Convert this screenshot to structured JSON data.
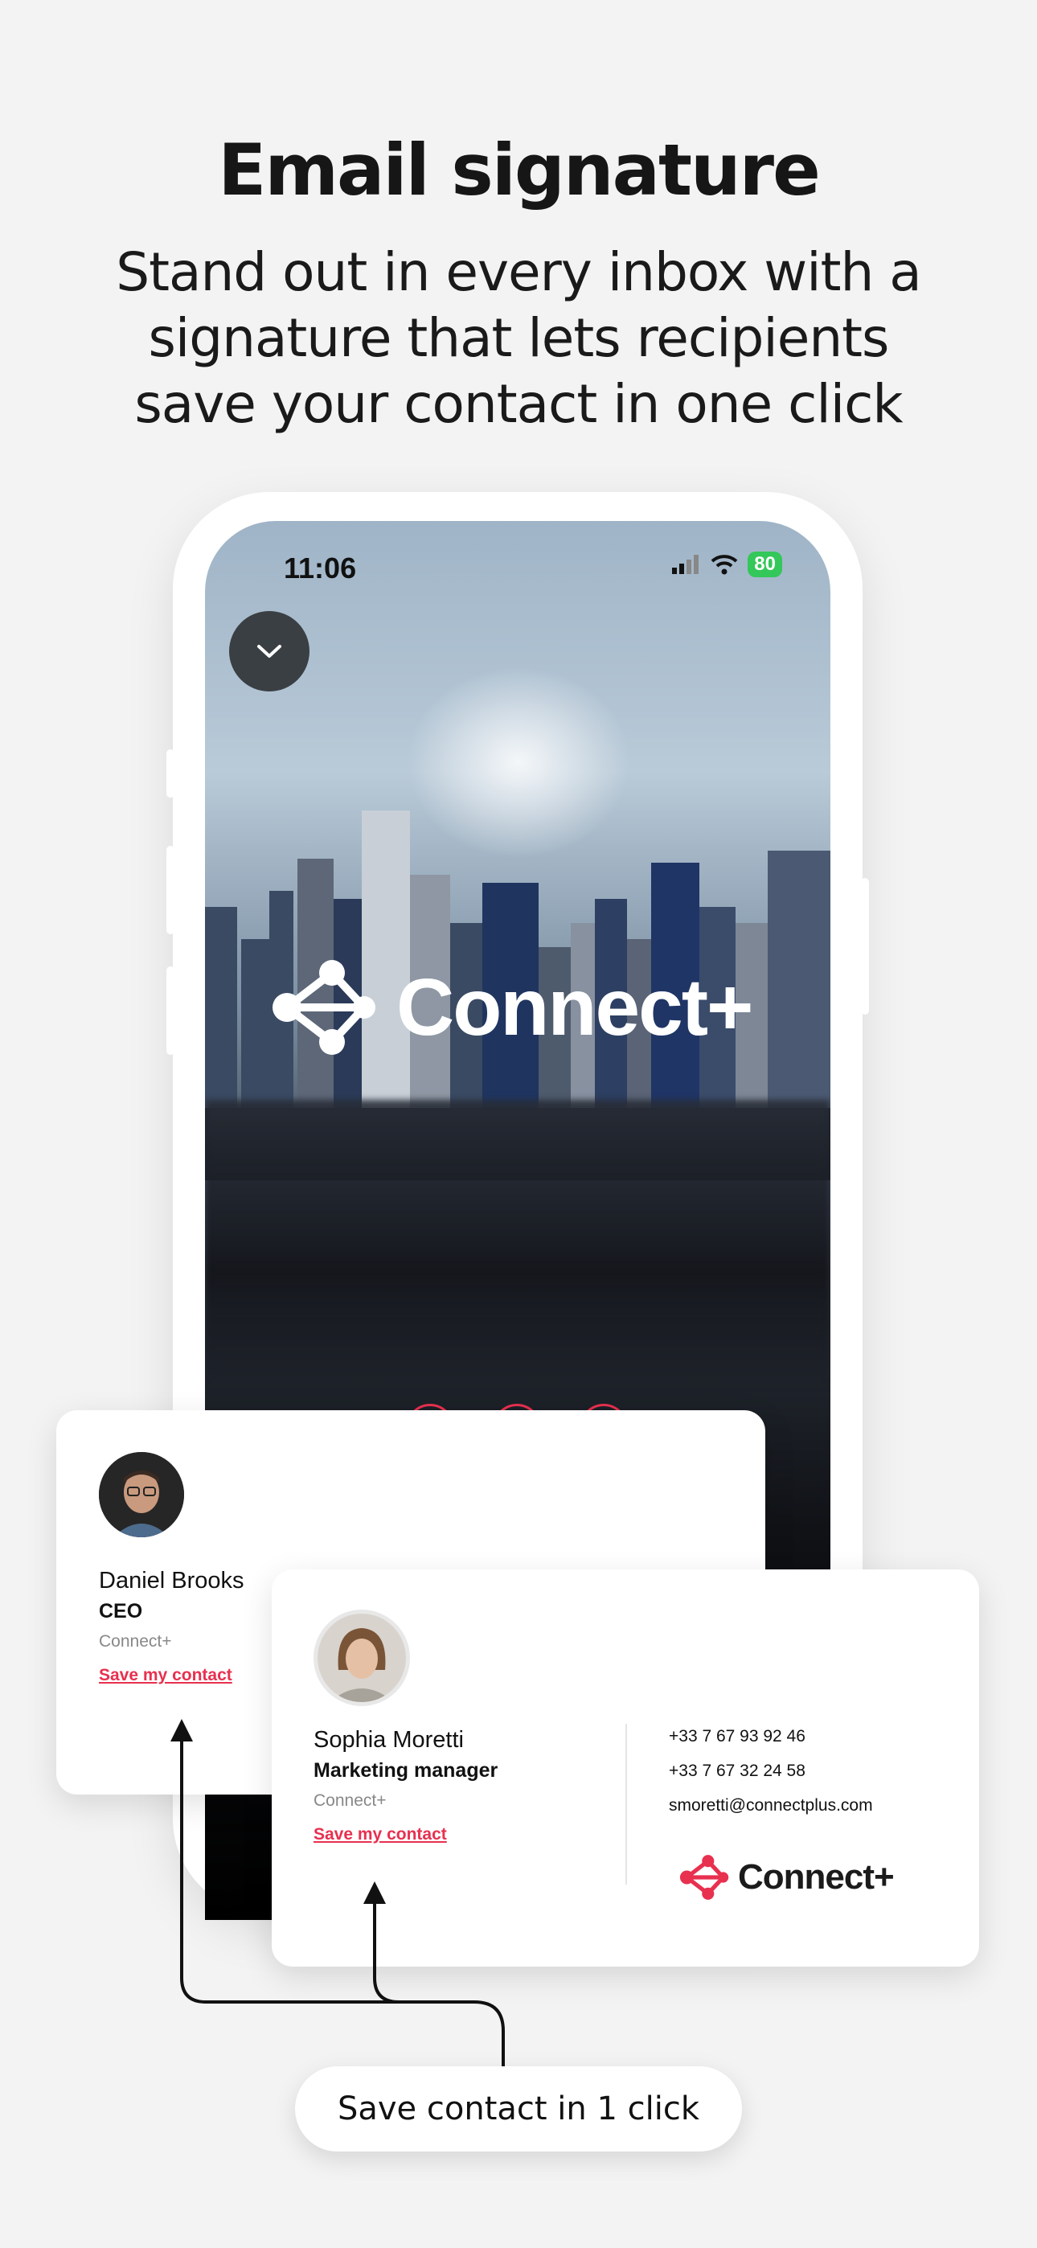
{
  "header": {
    "title": "Email signature",
    "subtitle": "Stand out in every inbox with a signature that lets recipients save your contact in one click"
  },
  "phone": {
    "time": "11:06",
    "battery": "80",
    "hero_brand": "Connect+"
  },
  "card_daniel": {
    "name": "Daniel Brooks",
    "role": "CEO",
    "company": "Connect+",
    "save_label": "Save my contact"
  },
  "card_sophia": {
    "name": "Sophia Moretti",
    "role": "Marketing manager",
    "company": "Connect+",
    "save_label": "Save my contact",
    "phone1": "+33 7 67 93 92 46",
    "phone2": "+33 7 67 32 24 58",
    "email": "smoretti@connectplus.com",
    "brand": "Connect+"
  },
  "cta": {
    "label": "Save contact in 1 click"
  },
  "colors": {
    "accent": "#e8304f",
    "background": "#f3f3f3",
    "battery": "#34c759"
  }
}
